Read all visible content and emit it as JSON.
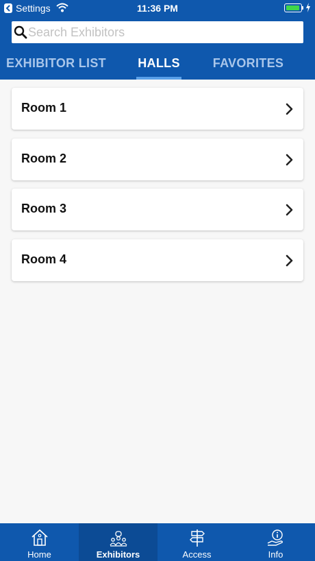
{
  "status_bar": {
    "back_label": "Settings",
    "time": "11:36 PM",
    "icons": [
      "back-arrow-icon",
      "wifi-icon",
      "battery-icon",
      "charging-bolt-icon"
    ],
    "battery_color": "#3fd74b"
  },
  "search": {
    "placeholder": "Search Exhibitors",
    "value": "",
    "icon": "search-icon"
  },
  "tabs": [
    {
      "label": "EXHIBITOR LIST",
      "active": false
    },
    {
      "label": "HALLS",
      "active": true
    },
    {
      "label": "FAVORITES",
      "active": false
    }
  ],
  "rooms": [
    {
      "label": "Room 1",
      "icon": "chevron-right-icon"
    },
    {
      "label": "Room 2",
      "icon": "chevron-right-icon"
    },
    {
      "label": "Room 3",
      "icon": "chevron-right-icon"
    },
    {
      "label": "Room 4",
      "icon": "chevron-right-icon"
    }
  ],
  "bottom_nav": [
    {
      "label": "Home",
      "icon": "home-icon",
      "active": false
    },
    {
      "label": "Exhibitors",
      "icon": "exhibitors-icon",
      "active": true
    },
    {
      "label": "Access",
      "icon": "signpost-icon",
      "active": false
    },
    {
      "label": "Info",
      "icon": "info-hand-icon",
      "active": false
    }
  ],
  "colors": {
    "brand_blue": "#0f58ad",
    "active_nav_blue": "#0c4b95",
    "tab_indicator": "#5aa0e8",
    "inactive_tab_text": "#a9c6ea",
    "background": "#f7f7f7"
  }
}
